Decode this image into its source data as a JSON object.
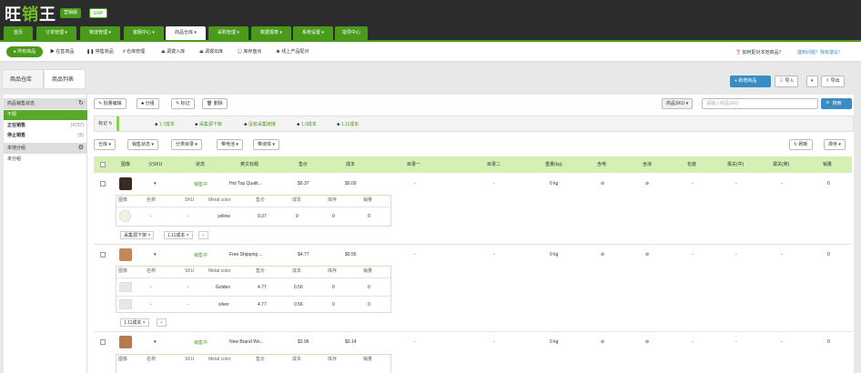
{
  "app": {
    "logo_a": "旺",
    "logo_b": "销",
    "logo_c": "王",
    "pill_trade": "营销版",
    "pill_erp": "ERP"
  },
  "nav": {
    "tabs": [
      "首页",
      "订单管理 ▾",
      "物流管理 ▾",
      "客服中心 ▾",
      "商品仓库 ▾",
      "采购管理 ▾",
      "数据报表 ▾",
      "系统设置 ▾",
      "指导中心"
    ]
  },
  "sub": {
    "all_products": "● 所有商品",
    "items": [
      "▶ 在售商品",
      "❚❚ 停售商品",
      "# 仓库管理",
      "⏏ 调拨入库",
      "⏏ 调拨出库",
      "▤ 库存盘点",
      "★ 线上产品配对"
    ],
    "help1": "❓ 如何配对本地商品？",
    "help2": "遇到问题？我有建议！"
  },
  "crumbs": {
    "c1": "商品仓库",
    "c2": "商品列表"
  },
  "actions": {
    "add": "+ 新增商品",
    "import": "⇩ 导入",
    "caret": "▾",
    "export": "⇪ 导出"
  },
  "left": {
    "status_header": "商品销售状态",
    "items": [
      {
        "label": "不限",
        "count": ""
      },
      {
        "label": "正在销售",
        "count": "(4737)"
      },
      {
        "label": "停止销售",
        "count": "(5)"
      }
    ],
    "group_header": "本地分组",
    "group_item": "未分组"
  },
  "toolbar": {
    "batch_edit": "✎ 批量编辑",
    "group": "♣ 分组",
    "mark": "✎ 标记",
    "delete": "🗑 删除",
    "sku_select": "商品SKU ▾",
    "search_placeholder": "请输入商品SKU",
    "search_btn": "🔍 搜索"
  },
  "tags": {
    "label": "标记 ↻",
    "items": [
      "1.7成本",
      "采集源下架",
      "没有采集链接",
      "1.9成本",
      "1.11成本"
    ]
  },
  "filters": {
    "items": [
      "仓库 ▾",
      "销售状态 ▾",
      "分类目录 ▾",
      "带电池 ▾",
      "带液体 ▾"
    ],
    "refresh": "↻ 刷新",
    "sort": "排序 ▾"
  },
  "table": {
    "headers": [
      "图像",
      "父SKU",
      "状态",
      "英文标题",
      "售价",
      "成本",
      "目录一",
      "目录二",
      "重量(kg)",
      "含电",
      "含液",
      "包装",
      "报关(中)",
      "报关(英)",
      "销量"
    ],
    "sub_headers": [
      "图像",
      "名称",
      "SKU",
      "Metal color",
      "售价",
      "成本",
      "库存",
      "销量"
    ],
    "rows": [
      {
        "sku": "▾",
        "status": "销售中",
        "title": "Hot Top Qualit...",
        "price": "$9.37",
        "cost": "$0.00",
        "cat1": "-",
        "cat2": "-",
        "weight": "0 kg",
        "elec": "⊘",
        "liquid": "⊘",
        "pack": "-",
        "customs_cn": "-",
        "customs_en": "-",
        "sales": "0",
        "variants": [
          {
            "name": "-",
            "sku": "-",
            "color": "yellow",
            "price": "9.37",
            "cost": "0",
            "stock": "0",
            "sales": "0"
          }
        ],
        "tags": [
          "采集源下架 ×",
          "1.11成本 ×",
          "+"
        ]
      },
      {
        "sku": "▾",
        "status": "销售中",
        "title": "Free Shipping ...",
        "price": "$4.77",
        "cost": "$0.56",
        "cat1": "-",
        "cat2": "-",
        "weight": "0 kg",
        "elec": "⊘",
        "liquid": "⊘",
        "pack": "-",
        "customs_cn": "-",
        "customs_en": "-",
        "sales": "0",
        "variants": [
          {
            "name": "-",
            "sku": "-",
            "color": "Golden",
            "price": "4.77",
            "cost": "0.56",
            "stock": "0",
            "sales": "0"
          },
          {
            "name": "-",
            "sku": "-",
            "color": "silver",
            "price": "4.77",
            "cost": "0.56",
            "stock": "0",
            "sales": "0"
          }
        ],
        "tags": [
          "1.11成本 ×",
          "+"
        ]
      },
      {
        "sku": "▾",
        "status": "销售中",
        "title": "New Brand Wo...",
        "price": "$3.96",
        "cost": "$0.14",
        "cat1": "-",
        "cat2": "-",
        "weight": "0 kg",
        "elec": "⊘",
        "liquid": "⊘",
        "pack": "-",
        "customs_cn": "-",
        "customs_en": "-",
        "sales": "0",
        "variants": [],
        "tags": []
      }
    ]
  },
  "colors": {
    "brand_green": "#4a9a1c",
    "header_green": "#d6f0b4",
    "blue": "#3a8cc4"
  }
}
